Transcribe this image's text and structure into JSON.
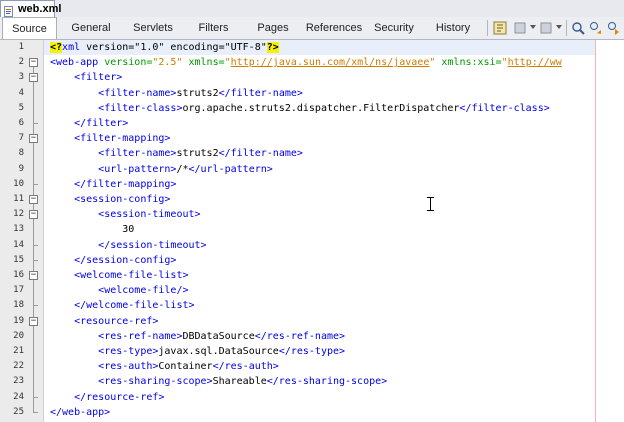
{
  "file_tab": {
    "label": "web.xml"
  },
  "view_tabs": [
    {
      "label": "Source",
      "active": true
    },
    {
      "label": "General",
      "active": false
    },
    {
      "label": "Servlets",
      "active": false
    },
    {
      "label": "Filters",
      "active": false
    },
    {
      "label": "Pages",
      "active": false
    },
    {
      "label": "References",
      "active": false
    },
    {
      "label": "Security",
      "active": false
    },
    {
      "label": "History",
      "active": false
    }
  ],
  "toolbar_icons": [
    "go-to-source-icon",
    "back-icon",
    "forward-icon",
    "find-icon",
    "find-previous-icon",
    "find-next-icon"
  ],
  "colors": {
    "tag": "#0000e6",
    "attribute": "#009900",
    "value": "#ce7b00",
    "pi_highlight": "#f5f300",
    "current_line": "#e9effa",
    "right_margin": "#f2b8b8"
  },
  "lines": [
    {
      "num": "1",
      "parts": [
        [
          "pi",
          "<?"
        ],
        [
          "tag",
          "xml"
        ],
        [
          "txt",
          " version=\"1.0\" encoding=\"UTF-8\""
        ],
        [
          "pi",
          "?>"
        ]
      ]
    },
    {
      "num": "2",
      "parts": [
        [
          "tag",
          "<web-app"
        ],
        [
          "attr",
          " version="
        ],
        [
          "val",
          "\"2.5\""
        ],
        [
          "attr",
          " xmlns="
        ],
        [
          "val",
          "\""
        ],
        [
          "url",
          "http://java.sun.com/xml/ns/javaee"
        ],
        [
          "val",
          "\""
        ],
        [
          "attr",
          " xmlns:xsi="
        ],
        [
          "val",
          "\""
        ],
        [
          "url",
          "http://ww"
        ]
      ]
    },
    {
      "num": "3",
      "parts": [
        [
          "txt",
          "    "
        ],
        [
          "tag",
          "<filter>"
        ]
      ]
    },
    {
      "num": "4",
      "parts": [
        [
          "txt",
          "        "
        ],
        [
          "tag",
          "<filter-name>"
        ],
        [
          "txt",
          "struts2"
        ],
        [
          "tag",
          "</filter-name>"
        ]
      ]
    },
    {
      "num": "5",
      "parts": [
        [
          "txt",
          "        "
        ],
        [
          "tag",
          "<filter-class>"
        ],
        [
          "txt",
          "org.apache.struts2.dispatcher.FilterDispatcher"
        ],
        [
          "tag",
          "</filter-class>"
        ]
      ]
    },
    {
      "num": "6",
      "parts": [
        [
          "txt",
          "    "
        ],
        [
          "tag",
          "</filter>"
        ]
      ]
    },
    {
      "num": "7",
      "parts": [
        [
          "txt",
          "    "
        ],
        [
          "tag",
          "<filter-mapping>"
        ]
      ]
    },
    {
      "num": "8",
      "parts": [
        [
          "txt",
          "        "
        ],
        [
          "tag",
          "<filter-name>"
        ],
        [
          "txt",
          "struts2"
        ],
        [
          "tag",
          "</filter-name>"
        ]
      ]
    },
    {
      "num": "9",
      "parts": [
        [
          "txt",
          "        "
        ],
        [
          "tag",
          "<url-pattern>"
        ],
        [
          "txt",
          "/*"
        ],
        [
          "tag",
          "</url-pattern>"
        ]
      ]
    },
    {
      "num": "10",
      "parts": [
        [
          "txt",
          "    "
        ],
        [
          "tag",
          "</filter-mapping>"
        ]
      ]
    },
    {
      "num": "11",
      "parts": [
        [
          "txt",
          "    "
        ],
        [
          "tag",
          "<session-config>"
        ]
      ]
    },
    {
      "num": "12",
      "parts": [
        [
          "txt",
          "        "
        ],
        [
          "tag",
          "<session-timeout>"
        ]
      ]
    },
    {
      "num": "13",
      "parts": [
        [
          "txt",
          "            30"
        ]
      ]
    },
    {
      "num": "14",
      "parts": [
        [
          "txt",
          "        "
        ],
        [
          "tag",
          "</session-timeout>"
        ]
      ]
    },
    {
      "num": "15",
      "parts": [
        [
          "txt",
          "    "
        ],
        [
          "tag",
          "</session-config>"
        ]
      ]
    },
    {
      "num": "16",
      "parts": [
        [
          "txt",
          "    "
        ],
        [
          "tag",
          "<welcome-file-list>"
        ]
      ]
    },
    {
      "num": "17",
      "parts": [
        [
          "txt",
          "        "
        ],
        [
          "tag",
          "<welcome-file/>"
        ]
      ]
    },
    {
      "num": "18",
      "parts": [
        [
          "txt",
          "    "
        ],
        [
          "tag",
          "</welcome-file-list>"
        ]
      ]
    },
    {
      "num": "19",
      "parts": [
        [
          "txt",
          "    "
        ],
        [
          "tag",
          "<resource-ref>"
        ]
      ]
    },
    {
      "num": "20",
      "parts": [
        [
          "txt",
          "        "
        ],
        [
          "tag",
          "<res-ref-name>"
        ],
        [
          "txt",
          "DBDataSource"
        ],
        [
          "tag",
          "</res-ref-name>"
        ]
      ]
    },
    {
      "num": "21",
      "parts": [
        [
          "txt",
          "        "
        ],
        [
          "tag",
          "<res-type>"
        ],
        [
          "txt",
          "javax.sql.DataSource"
        ],
        [
          "tag",
          "</res-type>"
        ]
      ]
    },
    {
      "num": "22",
      "parts": [
        [
          "txt",
          "        "
        ],
        [
          "tag",
          "<res-auth>"
        ],
        [
          "txt",
          "Container"
        ],
        [
          "tag",
          "</res-auth>"
        ]
      ]
    },
    {
      "num": "23",
      "parts": [
        [
          "txt",
          "        "
        ],
        [
          "tag",
          "<res-sharing-scope>"
        ],
        [
          "txt",
          "Shareable"
        ],
        [
          "tag",
          "</res-sharing-scope>"
        ]
      ]
    },
    {
      "num": "24",
      "parts": [
        [
          "txt",
          "    "
        ],
        [
          "tag",
          "</resource-ref>"
        ]
      ]
    },
    {
      "num": "25",
      "parts": [
        [
          "tag",
          "</web-app>"
        ]
      ]
    }
  ]
}
